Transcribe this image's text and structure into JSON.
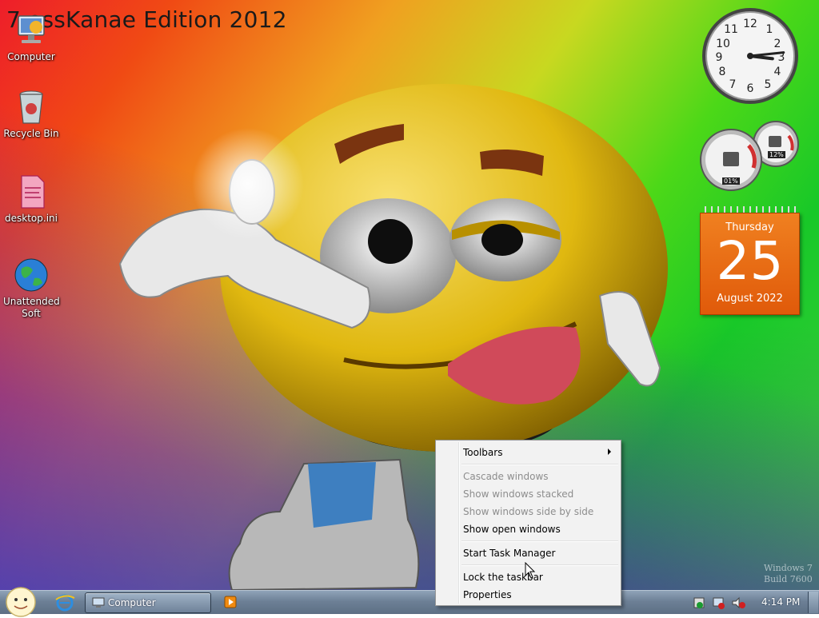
{
  "desktop": {
    "title": "7 ossKanae Edition 2012",
    "icons": [
      {
        "label": "Computer"
      },
      {
        "label": "Recycle Bin"
      },
      {
        "label": "desktop.ini"
      },
      {
        "label": "Unattended Soft"
      }
    ],
    "watermark_line1": "Windows 7",
    "watermark_line2": "Build 7600"
  },
  "gadgets": {
    "clock": {
      "hour": 3,
      "minute": 14
    },
    "cpu_meter": {
      "cpu_percent": "01%",
      "memory_percent": "12%"
    },
    "calendar": {
      "day_name": "Thursday",
      "day_number": "25",
      "month_year": "August 2022"
    }
  },
  "taskbar": {
    "tasks": [
      {
        "label": "Computer"
      }
    ],
    "clock": "4:14 PM"
  },
  "context_menu": {
    "items": [
      {
        "label": "Toolbars",
        "enabled": true,
        "submenu": true
      },
      {
        "label": "Cascade windows",
        "enabled": false
      },
      {
        "label": "Show windows stacked",
        "enabled": false
      },
      {
        "label": "Show windows side by side",
        "enabled": false
      },
      {
        "label": "Show open windows",
        "enabled": true
      },
      {
        "label": "Start Task Manager",
        "enabled": true
      },
      {
        "label": "Lock the taskbar",
        "enabled": true
      },
      {
        "label": "Properties",
        "enabled": true
      }
    ]
  },
  "colors": {
    "calendar_orange": "#e96a14",
    "taskbar_blue": "#6d8096",
    "menu_bg": "#f2f2f2",
    "disabled_text": "#8d8d8d"
  }
}
